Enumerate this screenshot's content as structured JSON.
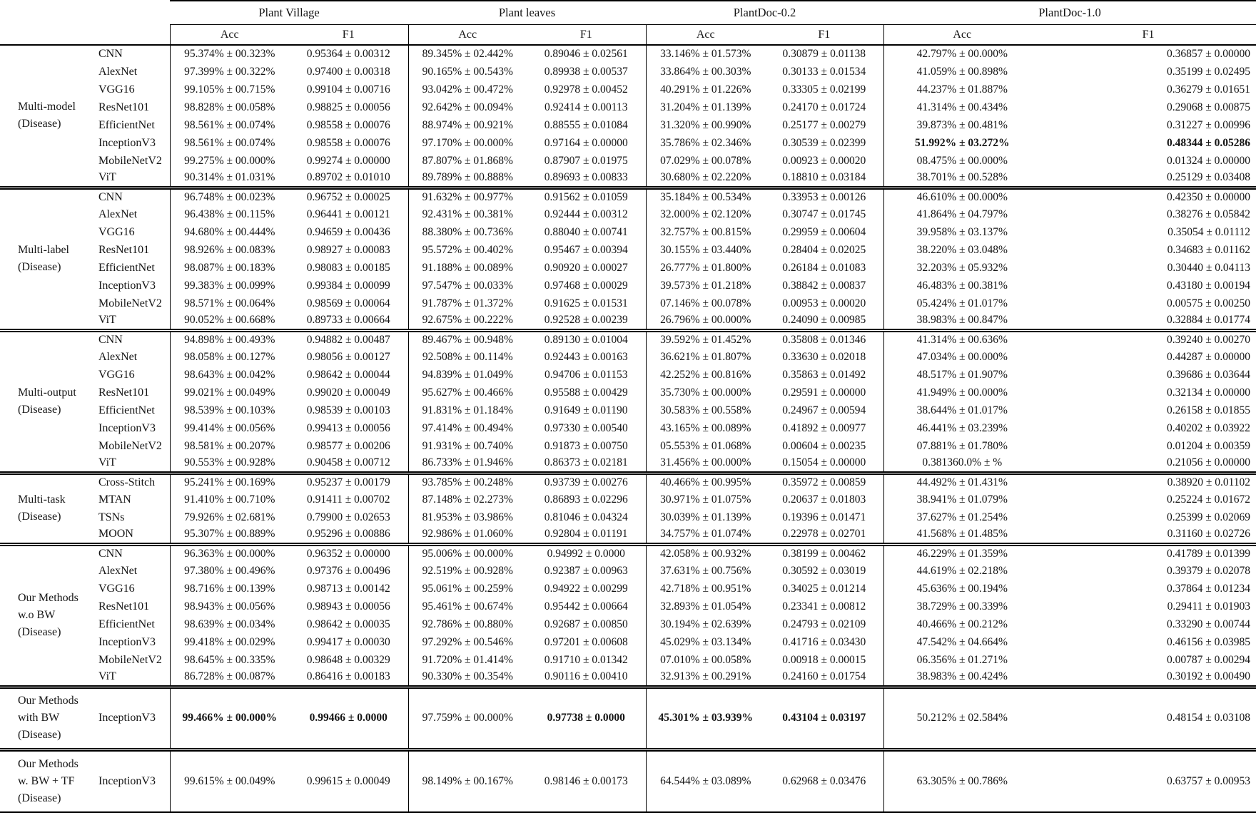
{
  "header": {
    "dataset_groups": [
      "Plant Village",
      "Plant leaves",
      "PlantDoc-0.2",
      "PlantDoc-1.0"
    ],
    "metrics": [
      "Acc",
      "F1"
    ]
  },
  "table": {
    "groups": [
      {
        "label_lines": [
          "Multi-model",
          "(Disease)"
        ],
        "rows": [
          {
            "model": "CNN",
            "cells": [
              "95.374% ± 00.323%",
              "0.95364 ± 0.00312",
              "89.345% ± 02.442%",
              "0.89046 ± 0.02561",
              "33.146% ± 01.573%",
              "0.30879 ± 0.01138",
              "42.797% ± 00.000%",
              "0.36857 ± 0.00000"
            ],
            "bold": []
          },
          {
            "model": "AlexNet",
            "cells": [
              "97.399% ± 00.322%",
              "0.97400 ± 0.00318",
              "90.165% ± 00.543%",
              "0.89938 ± 0.00537",
              "33.864% ± 00.303%",
              "0.30133 ± 0.01534",
              "41.059% ± 00.898%",
              "0.35199 ± 0.02495"
            ],
            "bold": []
          },
          {
            "model": "VGG16",
            "cells": [
              "99.105% ± 00.715%",
              "0.99104 ± 0.00716",
              "93.042% ± 00.472%",
              "0.92978 ± 0.00452",
              "40.291% ± 01.226%",
              "0.33305 ± 0.02199",
              "44.237% ± 01.887%",
              "0.36279 ± 0.01651"
            ],
            "bold": []
          },
          {
            "model": "ResNet101",
            "cells": [
              "98.828% ± 00.058%",
              "0.98825 ± 0.00056",
              "92.642% ± 00.094%",
              "0.92414 ± 0.00113",
              "31.204% ± 01.139%",
              "0.24170 ± 0.01724",
              "41.314% ± 00.434%",
              "0.29068 ± 0.00875"
            ],
            "bold": []
          },
          {
            "model": "EfficientNet",
            "cells": [
              "98.561% ± 00.074%",
              "0.98558 ± 0.00076",
              "88.974% ± 00.921%",
              "0.88555 ± 0.01084",
              "31.320% ± 00.990%",
              "0.25177 ± 0.00279",
              "39.873% ± 00.481%",
              "0.31227 ± 0.00996"
            ],
            "bold": []
          },
          {
            "model": "InceptionV3",
            "cells": [
              "98.561% ± 00.074%",
              "0.98558 ± 0.00076",
              "97.170% ± 00.000%",
              "0.97164 ± 0.00000",
              "35.786% ± 02.346%",
              "0.30539 ± 0.02399",
              "51.992% ± 03.272%",
              "0.48344 ± 0.05286"
            ],
            "bold": [
              6,
              7
            ]
          },
          {
            "model": "MobileNetV2",
            "cells": [
              "99.275% ± 00.000%",
              "0.99274 ± 0.00000",
              "87.807% ± 01.868%",
              "0.87907 ± 0.01975",
              "07.029% ± 00.078%",
              "0.00923 ± 0.00020",
              "08.475% ± 00.000%",
              "0.01324 ± 0.00000"
            ],
            "bold": []
          },
          {
            "model": "ViT",
            "cells": [
              "90.314% ± 01.031%",
              "0.89702 ± 0.01010",
              "89.789% ± 00.888%",
              "0.89693 ± 0.00833",
              "30.680% ± 02.220%",
              "0.18810 ± 0.03184",
              "38.701% ± 00.528%",
              "0.25129 ± 0.03408"
            ],
            "bold": []
          }
        ]
      },
      {
        "label_lines": [
          "Multi-label",
          "(Disease)"
        ],
        "rows": [
          {
            "model": "CNN",
            "cells": [
              "96.748% ± 00.023%",
              "0.96752 ± 0.00025",
              "91.632% ± 00.977%",
              "0.91562 ± 0.01059",
              "35.184% ± 00.534%",
              "0.33953 ± 0.00126",
              "46.610% ± 00.000%",
              "0.42350 ± 0.00000"
            ],
            "bold": []
          },
          {
            "model": "AlexNet",
            "cells": [
              "96.438% ± 00.115%",
              "0.96441 ± 0.00121",
              "92.431% ± 00.381%",
              "0.92444 ± 0.00312",
              "32.000% ± 02.120%",
              "0.30747 ± 0.01745",
              "41.864% ± 04.797%",
              "0.38276 ± 0.05842"
            ],
            "bold": []
          },
          {
            "model": "VGG16",
            "cells": [
              "94.680% ± 00.444%",
              "0.94659 ± 0.00436",
              "88.380% ± 00.736%",
              "0.88040 ± 0.00741",
              "32.757% ± 00.815%",
              "0.29959 ± 0.00604",
              "39.958% ± 03.137%",
              "0.35054 ± 0.01112"
            ],
            "bold": []
          },
          {
            "model": "ResNet101",
            "cells": [
              "98.926% ± 00.083%",
              "0.98927 ± 0.00083",
              "95.572% ± 00.402%",
              "0.95467 ± 0.00394",
              "30.155% ± 03.440%",
              "0.28404 ± 0.02025",
              "38.220% ± 03.048%",
              "0.34683 ± 0.01162"
            ],
            "bold": []
          },
          {
            "model": "EfficientNet",
            "cells": [
              "98.087% ± 00.183%",
              "0.98083 ± 0.00185",
              "91.188% ± 00.089%",
              "0.90920 ± 0.00027",
              "26.777% ± 01.800%",
              "0.26184 ± 0.01083",
              "32.203% ± 05.932%",
              "0.30440 ± 0.04113"
            ],
            "bold": []
          },
          {
            "model": "InceptionV3",
            "cells": [
              "99.383% ± 00.099%",
              "0.99384 ± 0.00099",
              "97.547% ± 00.033%",
              "0.97468 ± 0.00029",
              "39.573% ± 01.218%",
              "0.38842 ± 0.00837",
              "46.483% ± 00.381%",
              "0.43180 ± 0.00194"
            ],
            "bold": []
          },
          {
            "model": "MobileNetV2",
            "cells": [
              "98.571% ± 00.064%",
              "0.98569 ± 0.00064",
              "91.787% ± 01.372%",
              "0.91625 ± 0.01531",
              "07.146% ± 00.078%",
              "0.00953 ± 0.00020",
              "05.424% ± 01.017%",
              "0.00575 ± 0.00250"
            ],
            "bold": []
          },
          {
            "model": "ViT",
            "cells": [
              "90.052% ± 00.668%",
              "0.89733 ± 0.00664",
              "92.675% ± 00.222%",
              "0.92528 ± 0.00239",
              "26.796% ± 00.000%",
              "0.24090 ± 0.00985",
              "38.983% ± 00.847%",
              "0.32884 ± 0.01774"
            ],
            "bold": []
          }
        ]
      },
      {
        "label_lines": [
          "Multi-output",
          "(Disease)"
        ],
        "rows": [
          {
            "model": "CNN",
            "cells": [
              "94.898% ± 00.493%",
              "0.94882 ± 0.00487",
              "89.467% ± 00.948%",
              "0.89130 ± 0.01004",
              "39.592% ± 01.452%",
              "0.35808 ± 0.01346",
              "41.314% ± 00.636%",
              "0.39240 ± 0.00270"
            ],
            "bold": []
          },
          {
            "model": "AlexNet",
            "cells": [
              "98.058% ± 00.127%",
              "0.98056 ± 0.00127",
              "92.508% ± 00.114%",
              "0.92443 ± 0.00163",
              "36.621% ± 01.807%",
              "0.33630 ± 0.02018",
              "47.034% ± 00.000%",
              "0.44287 ± 0.00000"
            ],
            "bold": []
          },
          {
            "model": "VGG16",
            "cells": [
              "98.643% ± 00.042%",
              "0.98642 ± 0.00044",
              "94.839% ± 01.049%",
              "0.94706 ± 0.01153",
              "42.252% ± 00.816%",
              "0.35863 ± 0.01492",
              "48.517% ± 01.907%",
              "0.39686 ± 0.03644"
            ],
            "bold": []
          },
          {
            "model": "ResNet101",
            "cells": [
              "99.021% ± 00.049%",
              "0.99020 ± 0.00049",
              "95.627% ± 00.466%",
              "0.95588 ± 0.00429",
              "35.730% ± 00.000%",
              "0.29591 ± 0.00000",
              "41.949% ± 00.000%",
              "0.32134 ± 0.00000"
            ],
            "bold": []
          },
          {
            "model": "EfficientNet",
            "cells": [
              "98.539% ± 00.103%",
              "0.98539 ± 0.00103",
              "91.831% ± 01.184%",
              "0.91649 ± 0.01190",
              "30.583% ± 00.558%",
              "0.24967 ± 0.00594",
              "38.644% ± 01.017%",
              "0.26158 ± 0.01855"
            ],
            "bold": []
          },
          {
            "model": "InceptionV3",
            "cells": [
              "99.414% ± 00.056%",
              "0.99413 ± 0.00056",
              "97.414% ± 00.494%",
              "0.97330 ± 0.00540",
              "43.165% ± 00.089%",
              "0.41892 ± 0.00977",
              "46.441% ± 03.239%",
              "0.40202 ± 0.03922"
            ],
            "bold": []
          },
          {
            "model": "MobileNetV2",
            "cells": [
              "98.581% ± 00.207%",
              "0.98577 ± 0.00206",
              "91.931% ± 00.740%",
              "0.91873 ± 0.00750",
              "05.553% ± 01.068%",
              "0.00604 ± 0.00235",
              "07.881% ± 01.780%",
              "0.01204 ± 0.00359"
            ],
            "bold": []
          },
          {
            "model": "ViT",
            "cells": [
              "90.553% ± 00.928%",
              "0.90458 ± 0.00712",
              "86.733% ± 01.946%",
              "0.86373 ± 0.02181",
              "31.456% ± 00.000%",
              "0.15054 ± 0.00000",
              "0.381360.0% ± %",
              "0.21056 ± 0.00000"
            ],
            "bold": []
          }
        ]
      },
      {
        "label_lines": [
          "Multi-task",
          "(Disease)"
        ],
        "rows": [
          {
            "model": "Cross-Stitch",
            "cells": [
              "95.241% ± 00.169%",
              "0.95237 ± 0.00179",
              "93.785% ± 00.248%",
              "0.93739 ± 0.00276",
              "40.466% ± 00.995%",
              "0.35972 ± 0.00859",
              "44.492% ± 01.431%",
              "0.38920 ± 0.01102"
            ],
            "bold": []
          },
          {
            "model": "MTAN",
            "cells": [
              "91.410% ± 00.710%",
              "0.91411 ± 0.00702",
              "87.148% ± 02.273%",
              "0.86893 ± 0.02296",
              "30.971% ± 01.075%",
              "0.20637 ± 0.01803",
              "38.941% ± 01.079%",
              "0.25224 ± 0.01672"
            ],
            "bold": []
          },
          {
            "model": "TSNs",
            "cells": [
              "79.926% ± 02.681%",
              "0.79900 ± 0.02653",
              "81.953% ± 03.986%",
              "0.81046 ± 0.04324",
              "30.039% ± 01.139%",
              "0.19396 ± 0.01471",
              "37.627% ± 01.254%",
              "0.25399 ± 0.02069"
            ],
            "bold": []
          },
          {
            "model": "MOON",
            "cells": [
              "95.307% ± 00.889%",
              "0.95296 ± 0.00886",
              "92.986% ± 01.060%",
              "0.92804 ± 0.01191",
              "34.757% ± 01.074%",
              "0.22978 ± 0.02701",
              "41.568% ± 01.485%",
              "0.31160 ± 0.02726"
            ],
            "bold": []
          }
        ]
      },
      {
        "label_lines": [
          "Our Methods",
          "w.o BW",
          "(Disease)"
        ],
        "rows": [
          {
            "model": "CNN",
            "cells": [
              "96.363% ± 00.000%",
              "0.96352 ± 0.00000",
              "95.006% ± 00.000%",
              "0.94992 ± 0.0000",
              "42.058% ± 00.932%",
              "0.38199 ± 0.00462",
              "46.229% ± 01.359%",
              "0.41789 ± 0.01399"
            ],
            "bold": []
          },
          {
            "model": "AlexNet",
            "cells": [
              "97.380% ± 00.496%",
              "0.97376 ± 0.00496",
              "92.519% ± 00.928%",
              "0.92387 ± 0.00963",
              "37.631% ± 00.756%",
              "0.30592 ± 0.03019",
              "44.619% ± 02.218%",
              "0.39379 ± 0.02078"
            ],
            "bold": []
          },
          {
            "model": "VGG16",
            "cells": [
              "98.716% ± 00.139%",
              "0.98713 ± 0.00142",
              "95.061% ± 00.259%",
              "0.94922 ± 0.00299",
              "42.718% ± 00.951%",
              "0.34025 ± 0.01214",
              "45.636% ± 00.194%",
              "0.37864 ± 0.01234"
            ],
            "bold": []
          },
          {
            "model": "ResNet101",
            "cells": [
              "98.943% ± 00.056%",
              "0.98943 ± 0.00056",
              "95.461% ± 00.674%",
              "0.95442 ± 0.00664",
              "32.893% ± 01.054%",
              "0.23341 ± 0.00812",
              "38.729% ± 00.339%",
              "0.29411 ± 0.01903"
            ],
            "bold": []
          },
          {
            "model": "EfficientNet",
            "cells": [
              "98.639% ± 00.034%",
              "0.98642 ± 0.00035",
              "92.786% ± 00.880%",
              "0.92687 ± 0.00850",
              "30.194% ± 02.639%",
              "0.24793 ± 0.02109",
              "40.466% ± 00.212%",
              "0.33290 ± 0.00744"
            ],
            "bold": []
          },
          {
            "model": "InceptionV3",
            "cells": [
              "99.418% ± 00.029%",
              "0.99417 ± 0.00030",
              "97.292% ± 00.546%",
              "0.97201 ± 0.00608",
              "45.029% ± 03.134%",
              "0.41716 ± 0.03430",
              "47.542% ± 04.664%",
              "0.46156 ± 0.03985"
            ],
            "bold": []
          },
          {
            "model": "MobileNetV2",
            "cells": [
              "98.645% ± 00.335%",
              "0.98648 ± 0.00329",
              "91.720% ± 01.414%",
              "0.91710 ± 0.01342",
              "07.010% ± 00.058%",
              "0.00918 ± 0.00015",
              "06.356% ± 01.271%",
              "0.00787 ± 0.00294"
            ],
            "bold": []
          },
          {
            "model": "ViT",
            "cells": [
              "86.728% ± 00.087%",
              "0.86416 ± 0.00183",
              "90.330% ± 00.354%",
              "0.90116 ± 0.00410",
              "32.913% ± 00.291%",
              "0.24160 ± 0.01754",
              "38.983% ± 00.424%",
              "0.30192 ± 0.00490"
            ],
            "bold": []
          }
        ]
      },
      {
        "label_lines": [
          "Our Methods",
          "with BW",
          "(Disease)"
        ],
        "rows": [
          {
            "model": "InceptionV3",
            "cells": [
              "99.466% ± 00.000%",
              "0.99466 ± 0.0000",
              "97.759% ± 00.000%",
              "0.97738 ± 0.0000",
              "45.301% ± 03.939%",
              "0.43104 ± 0.03197",
              "50.212% ± 02.584%",
              "0.48154 ± 0.03108"
            ],
            "bold": [
              0,
              1,
              3,
              4,
              5
            ]
          }
        ]
      },
      {
        "label_lines": [
          "Our Methods",
          "w. BW + TF",
          "(Disease)"
        ],
        "rows": [
          {
            "model": "InceptionV3",
            "cells": [
              "99.615% ± 00.049%",
              "0.99615 ± 0.00049",
              "98.149% ± 00.167%",
              "0.98146 ± 0.00173",
              "64.544% ± 03.089%",
              "0.62968 ± 0.03476",
              "63.305% ± 00.786%",
              "0.63757 ± 0.00953"
            ],
            "bold": []
          }
        ]
      }
    ]
  }
}
